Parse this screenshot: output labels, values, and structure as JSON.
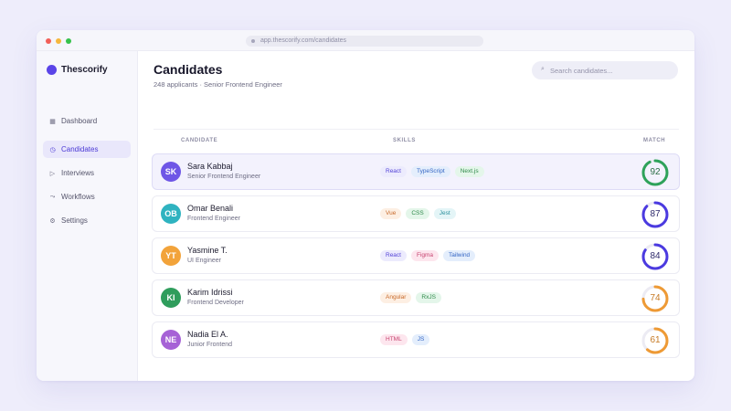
{
  "browser": {
    "url": "app.thescorify.com/candidates"
  },
  "brand": {
    "name": "Thescorify",
    "color": "#5a44e8"
  },
  "sidebar": {
    "items": [
      {
        "label": "Dashboard",
        "icon": "grid-icon",
        "active": false
      },
      {
        "label": "Candidates",
        "icon": "clock-icon",
        "active": true
      },
      {
        "label": "Interviews",
        "icon": "play-icon",
        "active": false
      },
      {
        "label": "Workflows",
        "icon": "arrow-icon",
        "active": false
      },
      {
        "label": "Settings",
        "icon": "gear-icon",
        "active": false
      }
    ]
  },
  "header": {
    "title": "Candidates",
    "subtitle": "248 applicants · Senior Frontend Engineer",
    "search_placeholder": "Search candidates..."
  },
  "table": {
    "columns": {
      "candidate": "CANDIDATE",
      "skills": "SKILLS",
      "match": "MATCH"
    },
    "rows": [
      {
        "initials": "SK",
        "name": "Sara Kabbaj",
        "role": "Senior Frontend Engineer",
        "avatar_color": "#6e56e6",
        "selected": true,
        "skills": [
          {
            "label": "React",
            "bg": "#ecebfd",
            "fg": "#5443d8"
          },
          {
            "label": "TypeScript",
            "bg": "#e4eefc",
            "fg": "#3466c4"
          },
          {
            "label": "Next.js",
            "bg": "#e4f6ea",
            "fg": "#2f8a4a"
          }
        ],
        "match": 92,
        "match_color": "#2ea25a"
      },
      {
        "initials": "OB",
        "name": "Omar Benali",
        "role": "Frontend Engineer",
        "avatar_color": "#2fb3c0",
        "selected": false,
        "skills": [
          {
            "label": "Vue",
            "bg": "#fdefe3",
            "fg": "#c86a2a"
          },
          {
            "label": "CSS",
            "bg": "#e4f6ea",
            "fg": "#2f8a4a"
          },
          {
            "label": "Jest",
            "bg": "#e4f5f7",
            "fg": "#2a8f9c"
          }
        ],
        "match": 87,
        "match_color": "#4b3ae0"
      },
      {
        "initials": "YT",
        "name": "Yasmine T.",
        "role": "UI Engineer",
        "avatar_color": "#f2a33a",
        "selected": false,
        "skills": [
          {
            "label": "React",
            "bg": "#ecebfd",
            "fg": "#5443d8"
          },
          {
            "label": "Figma",
            "bg": "#fde6ee",
            "fg": "#c6426f"
          },
          {
            "label": "Tailwind",
            "bg": "#e4eefc",
            "fg": "#3466c4"
          }
        ],
        "match": 84,
        "match_color": "#4b3ae0"
      },
      {
        "initials": "KI",
        "name": "Karim Idrissi",
        "role": "Frontend Developer",
        "avatar_color": "#2f9d5c",
        "selected": false,
        "skills": [
          {
            "label": "Angular",
            "bg": "#fdefe3",
            "fg": "#c86a2a"
          },
          {
            "label": "RxJS",
            "bg": "#e4f6ea",
            "fg": "#2f8a4a"
          }
        ],
        "match": 74,
        "match_color": "#ee9a35"
      },
      {
        "initials": "NE",
        "name": "Nadia El A.",
        "role": "Junior Frontend",
        "avatar_color": "#a662d6",
        "selected": false,
        "skills": [
          {
            "label": "HTML",
            "bg": "#fde6ee",
            "fg": "#c6426f"
          },
          {
            "label": "JS",
            "bg": "#e4eefc",
            "fg": "#3466c4"
          }
        ],
        "match": 61,
        "match_color": "#ee9a35"
      }
    ]
  }
}
